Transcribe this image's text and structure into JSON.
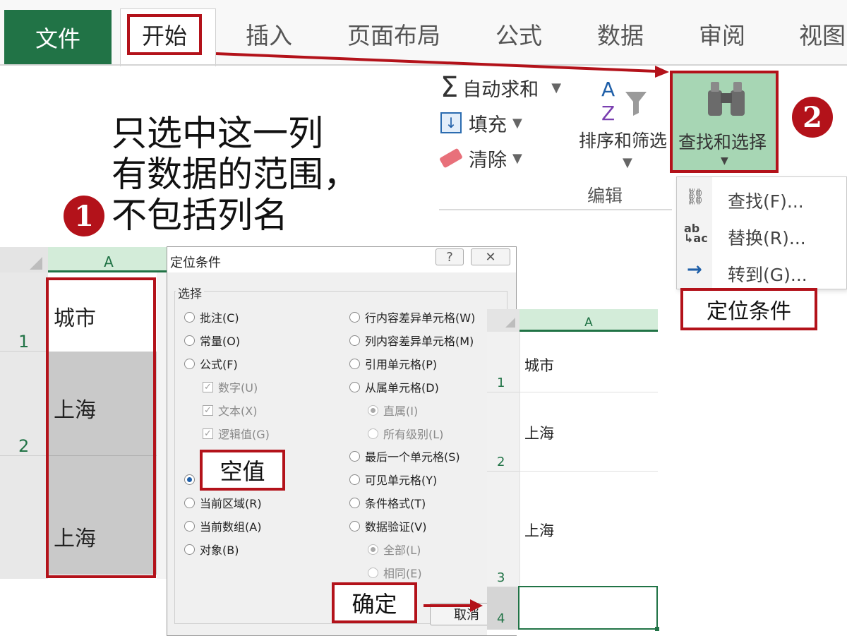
{
  "ribbon": {
    "tabs": {
      "file": "文件",
      "home": "开始",
      "insert": "插入",
      "page_layout": "页面布局",
      "formulas": "公式",
      "data": "数据",
      "review": "审阅",
      "view": "视图"
    },
    "editing": {
      "autosum": "自动求和",
      "fill": "填充",
      "clear": "清除",
      "sort_filter": "排序和筛选",
      "find_select": "查找和选择",
      "group_label": "编辑"
    },
    "find_menu": {
      "find": "查找(F)...",
      "replace": "替换(R)...",
      "goto": "转到(G)...",
      "goto_special": "定位条件"
    }
  },
  "annotations": {
    "step1": "1",
    "step2": "2",
    "instruction_lines": [
      "只选中这一列",
      "有数据的范围，",
      "不包括列名"
    ],
    "blank_label": "空值",
    "ok_label": "确定"
  },
  "left_sheet": {
    "column": "A",
    "rows": [
      "1",
      "2"
    ],
    "cells": [
      "城市",
      "上海",
      "上海"
    ]
  },
  "dialog": {
    "title": "定位条件",
    "help": "?",
    "close": "✕",
    "section": "选择",
    "left_options": [
      {
        "label": "批注(C)",
        "kind": "radio",
        "checked": false,
        "disabled": false
      },
      {
        "label": "常量(O)",
        "kind": "radio",
        "checked": false,
        "disabled": false
      },
      {
        "label": "公式(F)",
        "kind": "radio",
        "checked": false,
        "disabled": false
      },
      {
        "label": "数字(U)",
        "kind": "check",
        "checked": true,
        "disabled": true
      },
      {
        "label": "文本(X)",
        "kind": "check",
        "checked": true,
        "disabled": true
      },
      {
        "label": "逻辑值(G)",
        "kind": "check",
        "checked": true,
        "disabled": true
      }
    ],
    "left_options_lower": [
      {
        "label": "当前区域(R)",
        "checked": false
      },
      {
        "label": "当前数组(A)",
        "checked": false
      },
      {
        "label": "对象(B)",
        "checked": false
      }
    ],
    "right_options": [
      {
        "label": "行内容差异单元格(W)",
        "kind": "radio",
        "checked": false,
        "disabled": false,
        "indent": false
      },
      {
        "label": "列内容差异单元格(M)",
        "kind": "radio",
        "checked": false,
        "disabled": false,
        "indent": false
      },
      {
        "label": "引用单元格(P)",
        "kind": "radio",
        "checked": false,
        "disabled": false,
        "indent": false
      },
      {
        "label": "从属单元格(D)",
        "kind": "radio",
        "checked": false,
        "disabled": false,
        "indent": false
      },
      {
        "label": "直属(I)",
        "kind": "radio",
        "checked": true,
        "disabled": true,
        "indent": true
      },
      {
        "label": "所有级别(L)",
        "kind": "radio",
        "checked": false,
        "disabled": true,
        "indent": true
      },
      {
        "label": "最后一个单元格(S)",
        "kind": "radio",
        "checked": false,
        "disabled": false,
        "indent": false
      },
      {
        "label": "可见单元格(Y)",
        "kind": "radio",
        "checked": false,
        "disabled": false,
        "indent": false
      },
      {
        "label": "条件格式(T)",
        "kind": "radio",
        "checked": false,
        "disabled": false,
        "indent": false
      },
      {
        "label": "数据验证(V)",
        "kind": "radio",
        "checked": false,
        "disabled": false,
        "indent": false
      },
      {
        "label": "全部(L)",
        "kind": "radio",
        "checked": true,
        "disabled": true,
        "indent": true
      },
      {
        "label": "相同(E)",
        "kind": "radio",
        "checked": false,
        "disabled": true,
        "indent": true
      }
    ],
    "cancel": "取消"
  },
  "right_sheet": {
    "column": "A",
    "rows": [
      "1",
      "2",
      "3",
      "4"
    ],
    "cells": [
      "城市",
      "上海",
      "上海",
      ""
    ]
  },
  "colors": {
    "excel_green": "#217346",
    "highlight_red": "#b3121a",
    "find_button_bg": "#a7d6b4"
  }
}
